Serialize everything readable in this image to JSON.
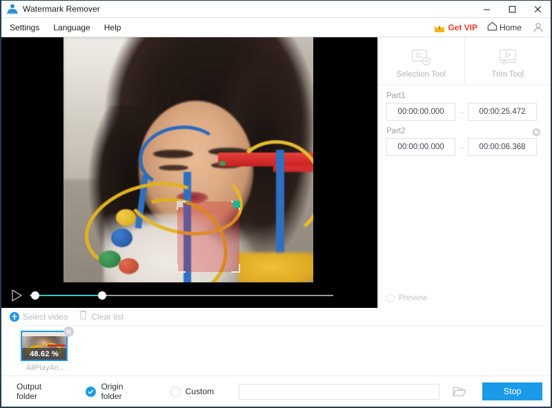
{
  "window": {
    "title": "Watermark Remover",
    "icon": "user-app-icon",
    "controls": {
      "minimize": "–",
      "maximize": "□",
      "close": "✕"
    }
  },
  "menubar": {
    "items": [
      {
        "label": "Settings",
        "name": "menu-settings"
      },
      {
        "label": "Language",
        "name": "menu-language"
      },
      {
        "label": "Help",
        "name": "menu-help"
      }
    ],
    "vip": {
      "label": "Get VIP",
      "icon": "crown-icon",
      "color": "#e23b2e"
    },
    "home": {
      "label": "Home",
      "icon": "home-icon"
    },
    "account": {
      "icon": "user-icon"
    }
  },
  "player": {
    "play_icon": "play-icon",
    "track": {
      "start_percent": 0,
      "end_percent": 22,
      "fill_color": "#25cfc3"
    }
  },
  "selection": {
    "overlay_color": "#d6262e",
    "handle_color": "#19b79a"
  },
  "tools": [
    {
      "label": "Selection Tool",
      "icon": "selection-tool-icon",
      "name": "tool-selection"
    },
    {
      "label": "Trim Tool",
      "icon": "trim-tool-icon",
      "name": "tool-trim"
    }
  ],
  "parts": [
    {
      "label": "Part1",
      "start": "00:00:00.000",
      "end": "00:00:25.472",
      "separator": "–",
      "removable": false
    },
    {
      "label": "Part2",
      "start": "00:00:00.000",
      "end": "00:00:06.368",
      "separator": "–",
      "removable": true,
      "remove_icon": "remove-circle-icon"
    }
  ],
  "preview": {
    "label": "Preview",
    "checked": false
  },
  "list_toolbar": {
    "select_video": {
      "label": "Select video",
      "icon": "plus-circle-icon"
    },
    "clear_list": {
      "label": "Clear list",
      "icon": "trash-icon"
    }
  },
  "file_list": [
    {
      "name": "AllPlayAn...",
      "progress": "48.62 %",
      "selected": true,
      "close_icon": "close-circle-icon"
    }
  ],
  "bottom": {
    "output_folder_label": "Output folder",
    "options": [
      {
        "label": "Origin folder",
        "selected": true
      },
      {
        "label": "Custom",
        "selected": false
      }
    ],
    "path_value": "",
    "path_placeholder": "",
    "browse_icon": "folder-open-icon",
    "action_button": {
      "label": "Stop",
      "color": "#1a9ae8"
    }
  }
}
